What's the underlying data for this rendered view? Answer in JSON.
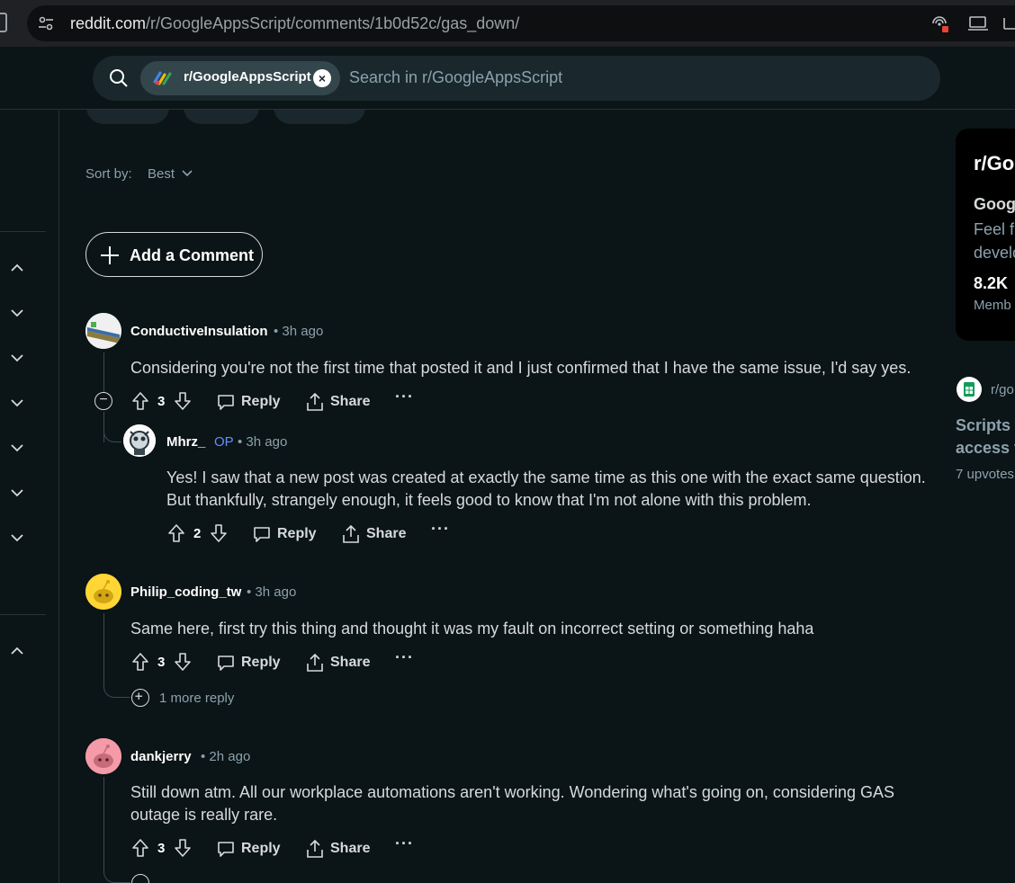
{
  "browser": {
    "url_host": "reddit.com",
    "url_path": "/r/GoogleAppsScript/comments/1b0d52c/gas_down/"
  },
  "search": {
    "chip_label": "r/GoogleAppsScript",
    "placeholder": "Search in r/GoogleAppsScript"
  },
  "sort": {
    "label": "Sort by:",
    "value": "Best"
  },
  "add_comment": {
    "label": "Add a Comment"
  },
  "comments": [
    {
      "author": "ConductiveInsulation",
      "time": "• 3h ago",
      "body": "Considering you're not the first time that posted it and I just confirmed that I have the same issue, I'd say yes.",
      "votes": "3",
      "reply": "Reply",
      "share": "Share",
      "more": "···"
    },
    {
      "author": "Mhrz_",
      "op": "OP",
      "time": "• 3h ago",
      "body": "Yes! I saw that a new post was created at exactly the same time as this one with the exact same question. But thankfully, strangely enough, it feels good to know that I'm not alone with this problem.",
      "votes": "2",
      "reply": "Reply",
      "share": "Share",
      "more": "···"
    },
    {
      "author": "Philip_coding_tw",
      "time": "• 3h ago",
      "body": "Same here, first try this thing and thought it was my fault on incorrect setting or something haha",
      "votes": "3",
      "reply": "Reply",
      "share": "Share",
      "more": "···",
      "more_replies": "1 more reply"
    },
    {
      "author": "dankjerry",
      "time": "• 2h ago",
      "body": "Still down atm. All our workplace automations aren't working. Wondering what's going on, considering GAS outage is really rare.",
      "votes": "3",
      "reply": "Reply",
      "share": "Share",
      "more": "···"
    }
  ],
  "sidebar": {
    "title": "r/Go",
    "subtitle": "Goog",
    "description": "Feel fr\ndevelo",
    "member_count": "8.2K",
    "member_label": "Memb"
  },
  "related": {
    "subreddit": "r/go",
    "title": "Scripts d\naccess th",
    "votes": "7 upvotes"
  },
  "icons": [
    "tune-icon",
    "cast-icon",
    "laptop-icon",
    "search-icon",
    "close-icon",
    "chevron-down-icon",
    "chevron-up-icon",
    "plus-icon",
    "upvote-icon",
    "downvote-icon",
    "reply-icon",
    "share-icon",
    "more-icon",
    "collapse-icon",
    "sheets-icon"
  ],
  "colors": {
    "background": "#0b1416",
    "op_accent": "#648efc",
    "muted": "#8ba2ad"
  }
}
